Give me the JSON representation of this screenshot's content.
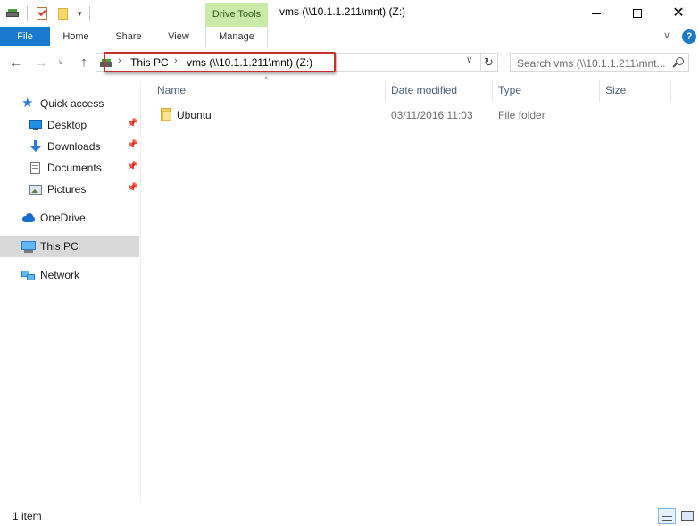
{
  "window": {
    "title": "vms (\\\\10.1.1.211\\mnt) (Z:)",
    "context_tab": "Drive Tools",
    "minimize_glyph": "",
    "close_glyph": "✕"
  },
  "quick_access_toolbar": {
    "icons": [
      "drive-icon",
      "properties-icon",
      "new-folder-icon"
    ],
    "dropdown_glyph": "▾"
  },
  "ribbon": {
    "tabs": [
      {
        "label": "File",
        "active": false
      },
      {
        "label": "Home",
        "active": false
      },
      {
        "label": "Share",
        "active": false
      },
      {
        "label": "View",
        "active": false
      },
      {
        "label": "Manage",
        "active": true
      }
    ],
    "expand_glyph": "∨",
    "help_glyph": "?",
    "file_tab_color": "#1979ca",
    "context_tab_color": "#c9eaa8"
  },
  "navigation": {
    "back_glyph": "←",
    "forward_glyph": "→",
    "recent_glyph": "∨",
    "up_glyph": "↑",
    "breadcrumb": [
      "This PC",
      "vms (\\\\10.1.1.211\\mnt) (Z:)"
    ],
    "separator_glyph": "›",
    "dropdown_glyph": "∨",
    "refresh_glyph": "↻",
    "highlight_color": "#c9302c"
  },
  "search": {
    "placeholder": "Search vms (\\\\10.1.1.211\\mnt..."
  },
  "nav_pane": {
    "pin_glyph": "📌",
    "items": [
      {
        "label": "Quick access",
        "icon": "star-icon",
        "pinned": false,
        "selected": false
      },
      {
        "label": "Desktop",
        "icon": "desktop-icon",
        "pinned": true,
        "selected": false
      },
      {
        "label": "Downloads",
        "icon": "downloads-icon",
        "pinned": true,
        "selected": false
      },
      {
        "label": "Documents",
        "icon": "documents-icon",
        "pinned": true,
        "selected": false
      },
      {
        "label": "Pictures",
        "icon": "pictures-icon",
        "pinned": true,
        "selected": false
      },
      {
        "label": "OneDrive",
        "icon": "onedrive-icon",
        "pinned": false,
        "selected": false
      },
      {
        "label": "This PC",
        "icon": "this-pc-icon",
        "pinned": false,
        "selected": true
      },
      {
        "label": "Network",
        "icon": "network-icon",
        "pinned": false,
        "selected": false
      }
    ]
  },
  "file_list": {
    "sort_glyph": "^",
    "columns": [
      "Name",
      "Date modified",
      "Type",
      "Size"
    ],
    "rows": [
      {
        "name": "Ubuntu",
        "date_modified": "03/11/2016 11:03",
        "type": "File folder",
        "size": "",
        "icon": "folder-icon"
      }
    ]
  },
  "status_bar": {
    "item_count": "1 item"
  }
}
